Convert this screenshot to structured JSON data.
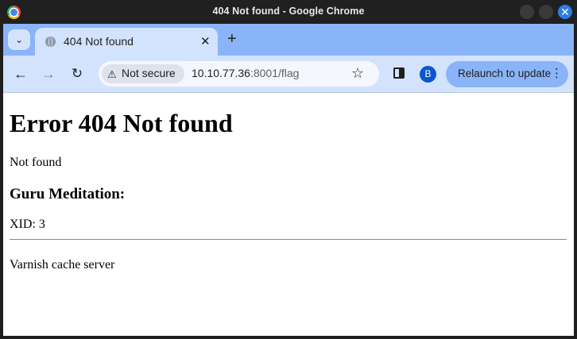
{
  "window": {
    "title": "404 Not found - Google Chrome",
    "close_glyph": "✕"
  },
  "tabs": {
    "search_glyph": "⌄",
    "active_tab_title": "404 Not found",
    "close_glyph": "✕",
    "new_tab_glyph": "+"
  },
  "toolbar": {
    "back_glyph": "←",
    "forward_glyph": "→",
    "reload_glyph": "↻",
    "security_icon": "⚠",
    "security_label": "Not secure",
    "url_host": "10.10.77.36",
    "url_rest": ":8001/flag",
    "bookmark_glyph": "☆",
    "profile_initial": "B",
    "relaunch_label": "Relaunch to update",
    "menu_glyph": "⋮"
  },
  "page": {
    "heading": "Error 404 Not found",
    "message": "Not found",
    "subheading": "Guru Meditation:",
    "xid": "XID: 3",
    "server": "Varnish cache server"
  },
  "colors": {
    "tabstrip": "#8ab4f8",
    "toolbar": "#d3e3fd",
    "relaunch_button": "#8ab4f8",
    "avatar": "#0b57d0"
  }
}
